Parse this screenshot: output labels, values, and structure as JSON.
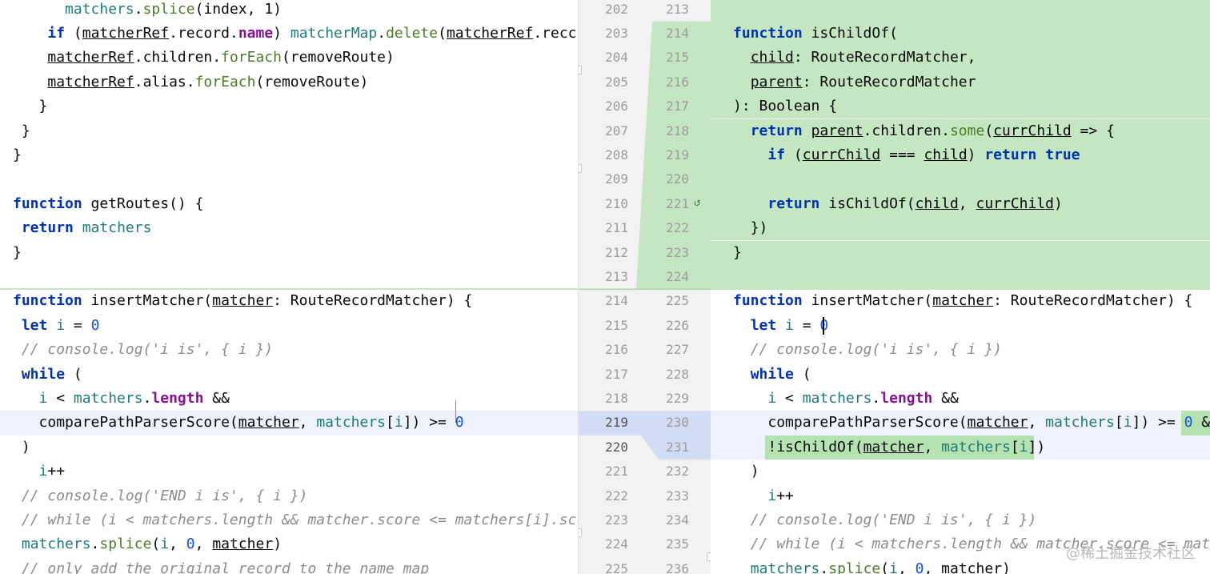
{
  "left": {
    "lines": [
      {
        "tokens": [
          [
            "      ",
            ""
          ],
          [
            "matchers",
            "member"
          ],
          [
            ".",
            "var"
          ],
          [
            "splice",
            "mtd"
          ],
          [
            "(index, 1)",
            "var"
          ]
        ]
      },
      {
        "tokens": [
          [
            "    ",
            ""
          ],
          [
            "if",
            "kw"
          ],
          [
            " (",
            "var"
          ],
          [
            "matcherRef",
            "var param"
          ],
          [
            ".record.",
            "var"
          ],
          [
            "name",
            "field"
          ],
          [
            ") ",
            "var"
          ],
          [
            "matcherMap",
            "member"
          ],
          [
            ".",
            "var"
          ],
          [
            "delete",
            "mtd"
          ],
          [
            "(",
            "var"
          ],
          [
            "matcherRef",
            "var param"
          ],
          [
            ".recc",
            "var"
          ]
        ]
      },
      {
        "tokens": [
          [
            "    ",
            ""
          ],
          [
            "matcherRef",
            "var param"
          ],
          [
            ".children.",
            "var"
          ],
          [
            "forEach",
            "mtd"
          ],
          [
            "(removeRoute)",
            "var"
          ]
        ]
      },
      {
        "tokens": [
          [
            "    ",
            ""
          ],
          [
            "matcherRef",
            "var param"
          ],
          [
            ".alias.",
            "var"
          ],
          [
            "forEach",
            "mtd"
          ],
          [
            "(removeRoute)",
            "var"
          ]
        ]
      },
      {
        "tokens": [
          [
            "   }",
            ""
          ]
        ]
      },
      {
        "tokens": [
          [
            " }",
            ""
          ]
        ]
      },
      {
        "tokens": [
          [
            "}",
            ""
          ]
        ]
      },
      {
        "tokens": []
      },
      {
        "tokens": [
          [
            "function",
            "kw"
          ],
          [
            " getRoutes() {",
            "var"
          ]
        ]
      },
      {
        "tokens": [
          [
            " ",
            ""
          ],
          [
            "return",
            "kw"
          ],
          [
            " ",
            "var"
          ],
          [
            "matchers",
            "member"
          ]
        ]
      },
      {
        "tokens": [
          [
            "}",
            ""
          ]
        ]
      },
      {
        "tokens": []
      },
      {
        "tokens": [
          [
            "function",
            "kw"
          ],
          [
            " insertMatcher(",
            "var"
          ],
          [
            "matcher",
            "var param"
          ],
          [
            ": RouteRecordMatcher) {",
            "var"
          ]
        ]
      },
      {
        "tokens": [
          [
            " ",
            ""
          ],
          [
            "let",
            "kw"
          ],
          [
            " ",
            "var"
          ],
          [
            "i",
            "member"
          ],
          [
            " = ",
            "var"
          ],
          [
            "0",
            "num"
          ]
        ]
      },
      {
        "tokens": [
          [
            " ",
            ""
          ],
          [
            "// console.log('i is', { i })",
            "cmt"
          ]
        ]
      },
      {
        "tokens": [
          [
            " ",
            ""
          ],
          [
            "while",
            "kw"
          ],
          [
            " (",
            "var"
          ]
        ]
      },
      {
        "tokens": [
          [
            "   ",
            ""
          ],
          [
            "i",
            "member"
          ],
          [
            " < ",
            "var"
          ],
          [
            "matchers",
            "member"
          ],
          [
            ".",
            "var"
          ],
          [
            "length",
            "field"
          ],
          [
            " &&",
            "var"
          ]
        ]
      },
      {
        "tokens": [
          [
            "   ",
            ""
          ],
          [
            "comparePathParserScore(",
            "var"
          ],
          [
            "matcher",
            "var param"
          ],
          [
            ", ",
            "var"
          ],
          [
            "matchers",
            "member"
          ],
          [
            "[",
            "var"
          ],
          [
            "i",
            "member"
          ],
          [
            "]) >= ",
            "var"
          ],
          [
            "0",
            "num"
          ]
        ]
      },
      {
        "tokens": [
          [
            " )",
            ""
          ]
        ]
      },
      {
        "tokens": [
          [
            "   ",
            ""
          ],
          [
            "i",
            "member"
          ],
          [
            "++",
            "var"
          ]
        ]
      },
      {
        "tokens": [
          [
            " ",
            ""
          ],
          [
            "// console.log('END i is', { i })",
            "cmt"
          ]
        ]
      },
      {
        "tokens": [
          [
            " ",
            ""
          ],
          [
            "// while (i < matchers.length && matcher.score <= matchers[i].scc",
            "cmt"
          ]
        ]
      },
      {
        "tokens": [
          [
            " ",
            ""
          ],
          [
            "matchers",
            "member"
          ],
          [
            ".",
            "var"
          ],
          [
            "splice",
            "mtd"
          ],
          [
            "(",
            "var"
          ],
          [
            "i",
            "member"
          ],
          [
            ", ",
            "var"
          ],
          [
            "0",
            "num"
          ],
          [
            ", ",
            "var"
          ],
          [
            "matcher",
            "var param"
          ],
          [
            ")",
            "var"
          ]
        ]
      },
      {
        "tokens": [
          [
            " ",
            ""
          ],
          [
            "// only add the original record to the name map",
            "cmt"
          ]
        ]
      }
    ]
  },
  "right": {
    "lines": [
      {
        "tokens": []
      },
      {
        "tokens": [
          [
            "",
            ""
          ],
          [
            "function",
            "kw"
          ],
          [
            " isChildOf(",
            "var"
          ]
        ]
      },
      {
        "tokens": [
          [
            "  ",
            ""
          ],
          [
            "child",
            "var param"
          ],
          [
            ": RouteRecordMatcher,",
            "var"
          ]
        ]
      },
      {
        "tokens": [
          [
            "  ",
            ""
          ],
          [
            "parent",
            "var param"
          ],
          [
            ": RouteRecordMatcher",
            "var"
          ]
        ]
      },
      {
        "tokens": [
          [
            "",
            ""
          ],
          [
            "): Boolean {",
            "var"
          ]
        ]
      },
      {
        "tokens": [
          [
            "  ",
            ""
          ],
          [
            "return",
            "kw"
          ],
          [
            " ",
            "var"
          ],
          [
            "parent",
            "var param"
          ],
          [
            ".children.",
            "var"
          ],
          [
            "some",
            "mtd"
          ],
          [
            "(",
            "var"
          ],
          [
            "currChild",
            "var param"
          ],
          [
            " => {",
            "var"
          ]
        ]
      },
      {
        "tokens": [
          [
            "    ",
            ""
          ],
          [
            "if",
            "kw"
          ],
          [
            " (",
            "var"
          ],
          [
            "currChild",
            "var param"
          ],
          [
            " === ",
            "var"
          ],
          [
            "child",
            "var param"
          ],
          [
            ") ",
            "var"
          ],
          [
            "return",
            "kw"
          ],
          [
            " ",
            "var"
          ],
          [
            "true",
            "kw"
          ]
        ]
      },
      {
        "tokens": []
      },
      {
        "tokens": [
          [
            "    ",
            ""
          ],
          [
            "return",
            "kw"
          ],
          [
            " isChildOf(",
            "var"
          ],
          [
            "child",
            "var param"
          ],
          [
            ", ",
            "var"
          ],
          [
            "currChild",
            "var param"
          ],
          [
            ")",
            "var"
          ]
        ]
      },
      {
        "tokens": [
          [
            "  ",
            ""
          ],
          [
            "})",
            "var"
          ]
        ]
      },
      {
        "tokens": [
          [
            "",
            ""
          ],
          [
            "}",
            "var"
          ]
        ]
      },
      {
        "tokens": []
      },
      {
        "tokens": [
          [
            "",
            ""
          ],
          [
            "function",
            "kw"
          ],
          [
            " insertMatcher(",
            "var"
          ],
          [
            "matcher",
            "var param"
          ],
          [
            ": RouteRecordMatcher) {",
            "var"
          ]
        ]
      },
      {
        "tokens": [
          [
            "  ",
            ""
          ],
          [
            "let",
            "kw"
          ],
          [
            " ",
            "var"
          ],
          [
            "i",
            "member"
          ],
          [
            " = ",
            "var"
          ],
          [
            "0",
            "num"
          ]
        ]
      },
      {
        "tokens": [
          [
            "  ",
            ""
          ],
          [
            "// console.log('i is', { i })",
            "cmt"
          ]
        ]
      },
      {
        "tokens": [
          [
            "  ",
            ""
          ],
          [
            "while",
            "kw"
          ],
          [
            " (",
            "var"
          ]
        ]
      },
      {
        "tokens": [
          [
            "    ",
            ""
          ],
          [
            "i",
            "member"
          ],
          [
            " < ",
            "var"
          ],
          [
            "matchers",
            "member"
          ],
          [
            ".",
            "var"
          ],
          [
            "length",
            "field"
          ],
          [
            " &&",
            "var"
          ]
        ]
      },
      {
        "tokens": [
          [
            "    ",
            ""
          ],
          [
            "comparePathParserScore(",
            "var"
          ],
          [
            "matcher",
            "var param"
          ],
          [
            ", ",
            "var"
          ],
          [
            "matchers",
            "member"
          ],
          [
            "[",
            "var"
          ],
          [
            "i",
            "member"
          ],
          [
            "]) >= ",
            "var"
          ],
          [
            "0",
            "num"
          ],
          [
            " &&",
            "var"
          ]
        ]
      },
      {
        "tokens": [
          [
            "    ",
            ""
          ],
          [
            "!isChildOf(",
            "var"
          ],
          [
            "matcher",
            "var param"
          ],
          [
            ", ",
            "var"
          ],
          [
            "matchers",
            "member"
          ],
          [
            "[",
            "var"
          ],
          [
            "i",
            "member"
          ],
          [
            "])",
            "var"
          ]
        ]
      },
      {
        "tokens": [
          [
            "  ",
            ""
          ],
          [
            ")",
            "var"
          ]
        ]
      },
      {
        "tokens": [
          [
            "    ",
            ""
          ],
          [
            "i",
            "member"
          ],
          [
            "++",
            "var"
          ]
        ]
      },
      {
        "tokens": [
          [
            "  ",
            ""
          ],
          [
            "// console.log('END i is', { i })",
            "cmt"
          ]
        ]
      },
      {
        "tokens": [
          [
            "  ",
            ""
          ],
          [
            "// while (i < matchers.length && matcher.score <= match",
            "cmt"
          ]
        ]
      },
      {
        "tokens": [
          [
            "  ",
            ""
          ],
          [
            "matchers",
            "member"
          ],
          [
            ".",
            "var"
          ],
          [
            "splice",
            "mtd"
          ],
          [
            "(",
            "var"
          ],
          [
            "i",
            "member"
          ],
          [
            ", ",
            "var"
          ],
          [
            "0",
            "num"
          ],
          [
            ", ",
            "var"
          ],
          [
            "matcher",
            "var param"
          ],
          [
            ")",
            "var"
          ]
        ]
      }
    ]
  },
  "gutter": {
    "left_numbers": [
      "202",
      "203",
      "204",
      "205",
      "206",
      "207",
      "208",
      "209",
      "210",
      "211",
      "212",
      "213",
      "214",
      "215",
      "216",
      "217",
      "218",
      "219",
      "220",
      "221",
      "222",
      "223",
      "224",
      "225"
    ],
    "right_numbers": [
      "213",
      "214",
      "215",
      "216",
      "217",
      "218",
      "219",
      "220",
      "221",
      "222",
      "223",
      "224",
      "225",
      "226",
      "227",
      "228",
      "229",
      "230",
      "231",
      "232",
      "233",
      "234",
      "235",
      "236"
    ]
  },
  "watermark": "@稀土掘金技术社区",
  "colors": {
    "added_bg": "#c4e7c1",
    "modified_bg": "#edf2fc",
    "gutter_bg": "#f2f2f2",
    "keyword": "#0033b3"
  }
}
